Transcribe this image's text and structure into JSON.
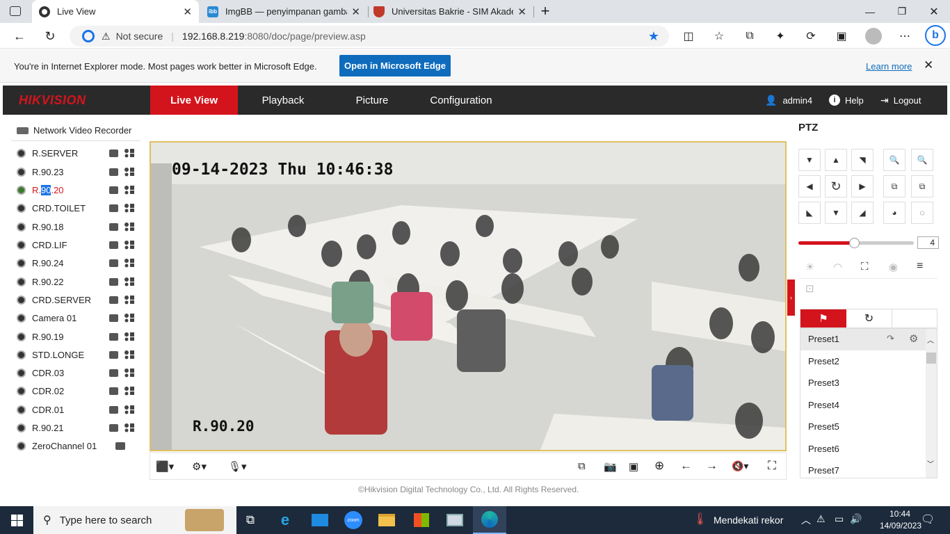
{
  "browser": {
    "tabs": [
      {
        "title": "Live View",
        "active": true,
        "favicon_color": "#333333"
      },
      {
        "title": "ImgBB — penyimpanan gambar g",
        "active": false,
        "favicon_color": "#2a8ad4",
        "favicon_text": "ibb"
      },
      {
        "title": "Universitas Bakrie - SIM Akadem",
        "active": false,
        "favicon_color": "#c0392b"
      }
    ],
    "new_tab_symbol": "+",
    "security_label": "Not secure",
    "url_host": "192.168.8.219",
    "url_rest": ":8080/doc/page/preview.asp",
    "ie_banner": {
      "message": "You're in Internet Explorer mode. Most pages work better in Microsoft Edge.",
      "open_button": "Open in Microsoft Edge",
      "learn_more": "Learn more"
    }
  },
  "app": {
    "logo": "HIKVISION",
    "nav": [
      {
        "label": "Live View",
        "active": true
      },
      {
        "label": "Playback",
        "active": false
      },
      {
        "label": "Picture",
        "active": false
      },
      {
        "label": "Configuration",
        "active": false
      }
    ],
    "user": "admin4",
    "help": "Help",
    "logout": "Logout",
    "device_title": "Network Video Recorder",
    "cameras": [
      {
        "name": "R.SERVER"
      },
      {
        "name": "R.90.23"
      },
      {
        "name": "R.90.20",
        "active": true,
        "prefix": "R.",
        "selected_part": "90",
        "suffix": ".20"
      },
      {
        "name": "CRD.TOILET"
      },
      {
        "name": "R.90.18"
      },
      {
        "name": "CRD.LIF"
      },
      {
        "name": "R.90.24"
      },
      {
        "name": "R.90.22"
      },
      {
        "name": "CRD.SERVER"
      },
      {
        "name": "Camera 01"
      },
      {
        "name": "R.90.19"
      },
      {
        "name": "STD.LONGE"
      },
      {
        "name": "CDR.03"
      },
      {
        "name": "CDR.02"
      },
      {
        "name": "CDR.01"
      },
      {
        "name": "R.90.21"
      },
      {
        "name": "ZeroChannel 01"
      }
    ],
    "video": {
      "osd_timestamp": "09-14-2023 Thu 10:46:38",
      "osd_channel": "R.90.20"
    },
    "ptz": {
      "title": "PTZ",
      "speed_value": "4",
      "speed_fraction": 0.48,
      "presets": [
        "Preset1",
        "Preset2",
        "Preset3",
        "Preset4",
        "Preset5",
        "Preset6",
        "Preset7"
      ]
    },
    "footer": "©Hikvision Digital Technology Co., Ltd. All Rights Reserved."
  },
  "taskbar": {
    "search_placeholder": "Type here to search",
    "weather": "Mendekati rekor",
    "time": "10:44",
    "date": "14/09/2023"
  },
  "colors": {
    "brand_red": "#d4141c",
    "edge_blue": "#0f6cbd",
    "header_dark": "#2a2a2a",
    "taskbar": "#1c2a3b"
  }
}
